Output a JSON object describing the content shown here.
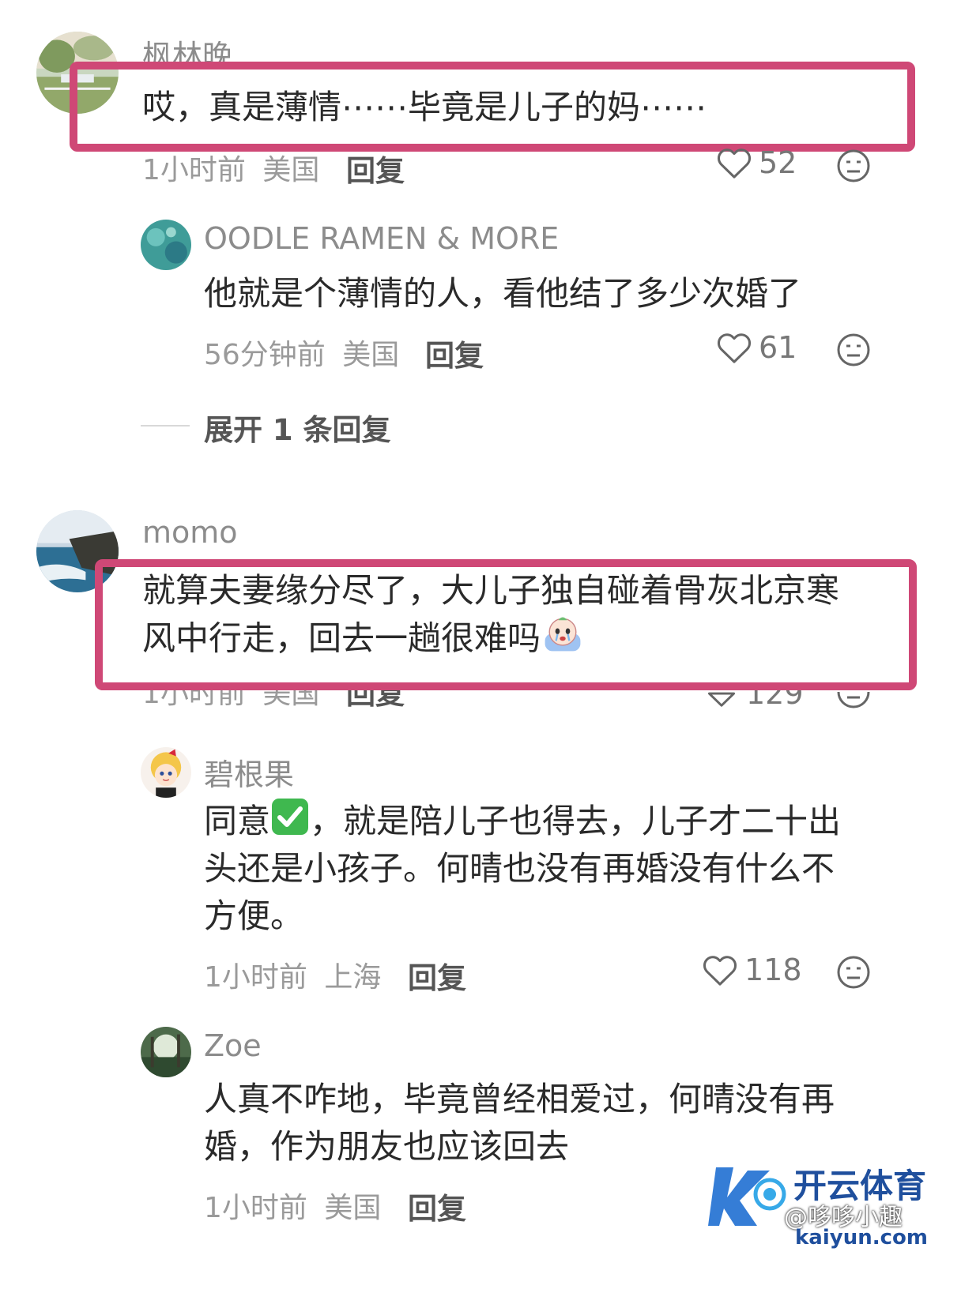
{
  "comments": [
    {
      "user": "枫林晚",
      "text": "哎，真是薄情⋯⋯毕竟是儿子的妈⋯⋯",
      "time": "1小时前",
      "location": "美国",
      "reply_label": "回复",
      "likes": "52",
      "replies": [
        {
          "user": "OODLE RAMEN & MORE",
          "text": "他就是个薄情的人，看他结了多少次婚了",
          "time": "56分钟前",
          "location": "美国",
          "reply_label": "回复",
          "likes": "61"
        }
      ],
      "expand_label": "展开 1 条回复"
    },
    {
      "user": "momo",
      "text_line1": "就算夫妻缘分尽了，大儿子独自碰着骨灰北京寒",
      "text_line2": "风中行走，回去一趟很难吗",
      "time": "1小时前",
      "location": "美国",
      "reply_label": "回复",
      "likes": "129",
      "replies": [
        {
          "user": "碧根果",
          "text_line1a": "同意",
          "text_line1b": "，就是陪儿子也得去，儿子才二十出",
          "text_line2": "头还是小孩子。何晴也没有再婚没有什么不",
          "text_line3": "方便。",
          "time": "1小时前",
          "location": "上海",
          "reply_label": "回复",
          "likes": "118"
        },
        {
          "user": "Zoe",
          "text_line1": "人真不咋地，毕竟曾经相爱过，何晴没有再",
          "text_line2": "婚，作为朋友也应该回去",
          "time": "1小时前",
          "location": "美国",
          "reply_label": "回复"
        }
      ]
    }
  ],
  "watermark": {
    "brand": "开云体育",
    "handle": "@哆哆小趣",
    "domain": "kaiyun.com"
  },
  "colors": {
    "highlight": "#cf4876",
    "username": "#8c8c8c",
    "text": "#2a2a2a",
    "meta": "#9a9a9a",
    "brand_blue": "#1f6fd1"
  }
}
